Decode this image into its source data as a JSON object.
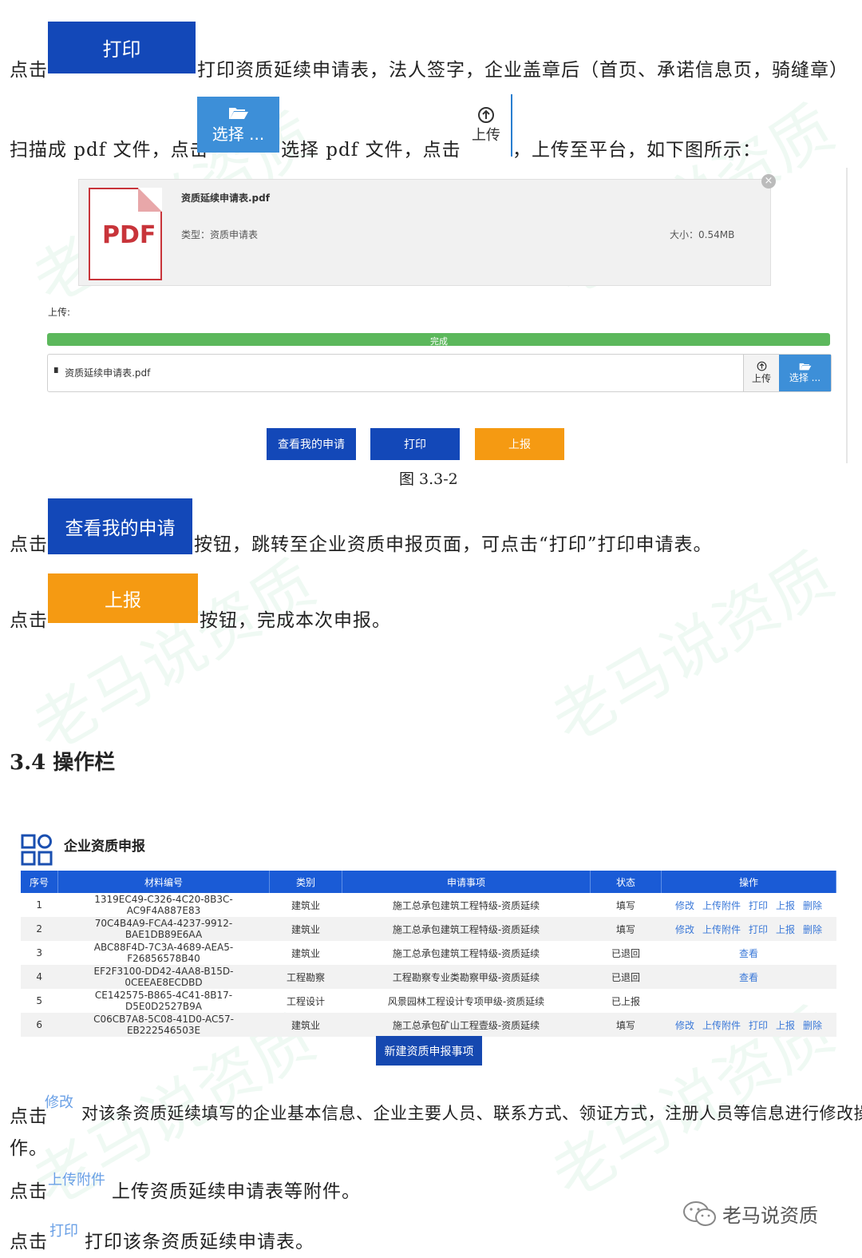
{
  "intro": {
    "click": "点击",
    "print_btn": "打印",
    "line1_rest": "打印资质延续申请表，法人签字，企业盖章后（首页、承诺信息页，骑缝章）",
    "line2_a": "扫描成 pdf 文件，点击",
    "select_btn": "选择 ...",
    "line2_b": "选择 pdf 文件，点击",
    "upload_btn": "上传",
    "line2_c": "，上传至平台，如下图所示："
  },
  "figure": {
    "pdf_badge": "PDF",
    "file_name": "资质延续申请表.pdf",
    "file_type": "类型：资质申请表",
    "file_size": "大小：0.54MB",
    "upload_label": "上传:",
    "progress_text": "完成",
    "progress": 1.0,
    "input_file": "资质延续申请表.pdf",
    "upload_small": "上传",
    "select_small": "选择 ...",
    "btn_view": "查看我的申请",
    "btn_print": "打印",
    "btn_submit": "上报",
    "caption": "图 3.3-2"
  },
  "desc1": {
    "btn": "查看我的申请",
    "rest": "按钮，跳转至企业资质申报页面，可点击“打印”打印申请表。"
  },
  "desc2": {
    "btn": "上报",
    "rest": "按钮，完成本次申报。"
  },
  "section_title": "3.4 操作栏",
  "panel": {
    "title": "企业资质申报",
    "headers": [
      "序号",
      "材料编号",
      "类别",
      "申请事项",
      "状态",
      "操作"
    ],
    "rows": [
      {
        "no": "1",
        "code": "1319EC49-C326-4C20-8B3C-AC9F4A887E83",
        "cat": "建筑业",
        "item": "施工总承包建筑工程特级-资质延续",
        "status": "填写",
        "ops": [
          "修改",
          "上传附件",
          "打印",
          "上报",
          "删除"
        ]
      },
      {
        "no": "2",
        "code": "70C4B4A9-FCA4-4237-9912-BAE1DB89E6AA",
        "cat": "建筑业",
        "item": "施工总承包建筑工程特级-资质延续",
        "status": "填写",
        "ops": [
          "修改",
          "上传附件",
          "打印",
          "上报",
          "删除"
        ]
      },
      {
        "no": "3",
        "code": "ABC88F4D-7C3A-4689-AEA5-F26856578B40",
        "cat": "建筑业",
        "item": "施工总承包建筑工程特级-资质延续",
        "status": "已退回",
        "ops": [
          "查看"
        ]
      },
      {
        "no": "4",
        "code": "EF2F3100-DD42-4AA8-B15D-0CEEAE8ECDBD",
        "cat": "工程勘察",
        "item": "工程勘察专业类勘察甲级-资质延续",
        "status": "已退回",
        "ops": [
          "查看"
        ]
      },
      {
        "no": "5",
        "code": "CE142575-B865-4C41-8B17-D5E0D2527B9A",
        "cat": "工程设计",
        "item": "风景园林工程设计专项甲级-资质延续",
        "status": "已上报",
        "ops": []
      },
      {
        "no": "6",
        "code": "C06CB7A8-5C08-41D0-AC57-EB222546503E",
        "cat": "建筑业",
        "item": "施工总承包矿山工程壹级-资质延续",
        "status": "填写",
        "ops": [
          "修改",
          "上传附件",
          "打印",
          "上报",
          "删除"
        ]
      }
    ],
    "new_btn": "新建资质申报事项"
  },
  "desc3": {
    "link": "修改",
    "rest": "对该条资质延续填写的企业基本信息、企业主要人员、联系方式、领证方式，注册人员等信息进行修改操",
    "rest2": "作。"
  },
  "desc4": {
    "link": "上传附件",
    "rest": "上传资质延续申请表等附件。"
  },
  "desc5": {
    "link": "打印",
    "rest": "打印该条资质延续申请表。"
  },
  "watermark": "老马说资质",
  "wechat_brand": "老马说资质"
}
